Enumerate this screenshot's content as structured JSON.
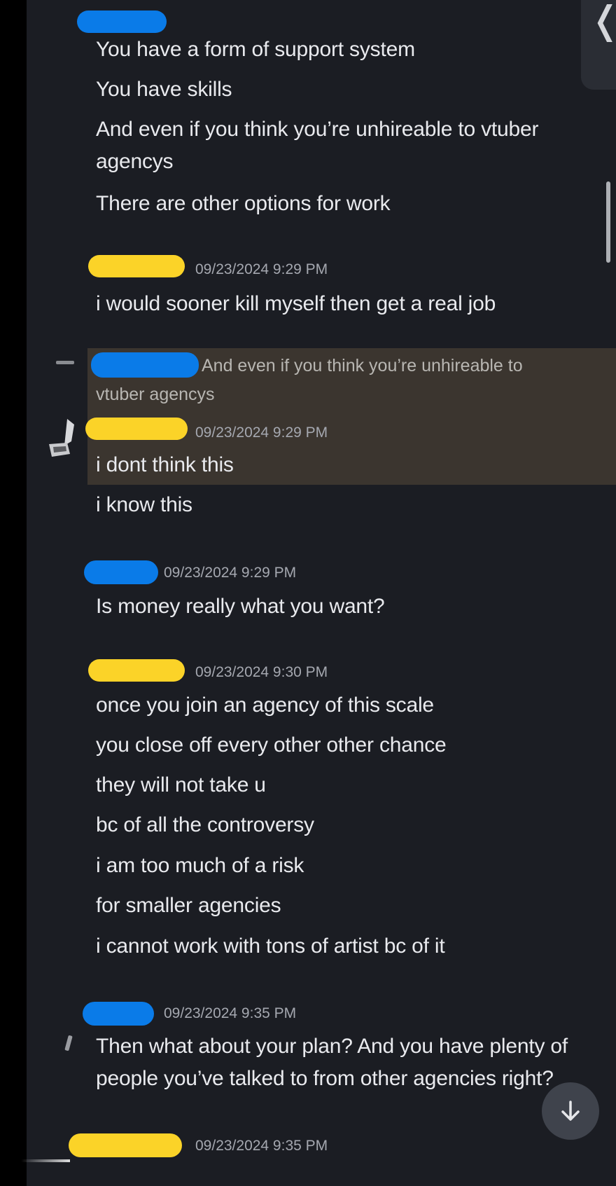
{
  "colors": {
    "background": "#1b1d23",
    "text": "#e9eaee",
    "timestamp": "#a5a8b0",
    "highlight": "#3b352f",
    "redact_blue": "#0a7be8",
    "redact_yellow": "#fbd328"
  },
  "messages": [
    {
      "author_color": "blue",
      "timestamp": "",
      "lines": [
        "You have a form of support system",
        "You have skills",
        "And even if you think you’re unhireable  to vtuber agencys",
        "There are other options for work"
      ]
    },
    {
      "author_color": "yellow",
      "timestamp": "09/23/2024 9:29 PM",
      "lines": [
        "i would sooner kill myself then get a real job"
      ]
    },
    {
      "author_color": "yellow",
      "timestamp": "09/23/2024 9:29 PM",
      "reply_to": {
        "author_color": "blue",
        "text": "And even if you think you’re unhireable  to vtuber agencys"
      },
      "highlighted": true,
      "lines": [
        "i dont think this",
        "i know this"
      ]
    },
    {
      "author_color": "blue",
      "timestamp": "09/23/2024 9:29 PM",
      "lines": [
        "Is money really what you want?"
      ]
    },
    {
      "author_color": "yellow",
      "timestamp": "09/23/2024 9:30 PM",
      "lines": [
        "once you join an agency of this scale",
        "you close off every other other chance",
        "they will not take u",
        "bc of all the controversy",
        "i am too much of a risk",
        "for smaller agencies",
        "i cannot work with tons of artist bc of it"
      ]
    },
    {
      "author_color": "blue",
      "timestamp": "09/23/2024 9:35 PM",
      "lines": [
        "Then what about your plan? And you have plenty of people you’ve talked to from other agencies right?"
      ]
    },
    {
      "author_color": "yellow",
      "timestamp": "09/23/2024 9:35 PM",
      "lines": []
    }
  ],
  "reply_preview": {
    "line1": "And even if you think you’re unhireable  to",
    "line2": "vtuber agencys"
  },
  "icons": {
    "collapse": "chevron-left-icon",
    "jump": "arrow-down-icon"
  }
}
